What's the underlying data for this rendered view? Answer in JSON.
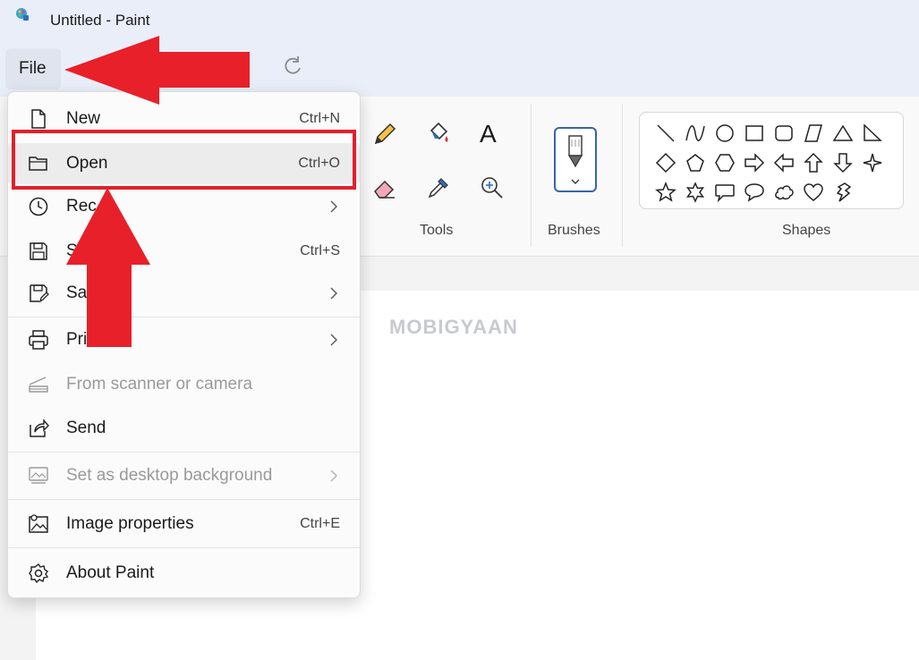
{
  "window": {
    "title": "Untitled - Paint"
  },
  "menubar": {
    "file_label": "File"
  },
  "ribbon": {
    "groups": [
      {
        "label": "Tools"
      },
      {
        "label": "Brushes"
      },
      {
        "label": "Shapes"
      }
    ]
  },
  "canvas": {
    "watermark": "MOBIGYAAN"
  },
  "file_menu": {
    "items": [
      {
        "label": "New",
        "shortcut": "Ctrl+N",
        "icon": "new-file-icon"
      },
      {
        "label": "Open",
        "shortcut": "Ctrl+O",
        "icon": "folder-icon"
      },
      {
        "label": "Rec",
        "shortcut": "",
        "icon": "clock-icon"
      },
      {
        "label": "S",
        "shortcut": "Ctrl+S",
        "icon": "save-icon"
      },
      {
        "label": "Sa",
        "shortcut": "",
        "icon": "save-as-icon"
      },
      {
        "label": "Pri",
        "shortcut": "",
        "icon": "printer-icon"
      },
      {
        "label": "From scanner or camera",
        "shortcut": "",
        "icon": "scanner-icon"
      },
      {
        "label": "Send",
        "shortcut": "",
        "icon": "share-icon"
      },
      {
        "label": "Set as desktop background",
        "shortcut": "",
        "icon": "desktop-background-icon"
      },
      {
        "label": "Image properties",
        "shortcut": "Ctrl+E",
        "icon": "image-properties-icon"
      },
      {
        "label": "About Paint",
        "shortcut": "",
        "icon": "gear-icon"
      }
    ]
  },
  "colors": {
    "annotation_red": "#e0202a",
    "brush_accent": "#3b64a8"
  }
}
